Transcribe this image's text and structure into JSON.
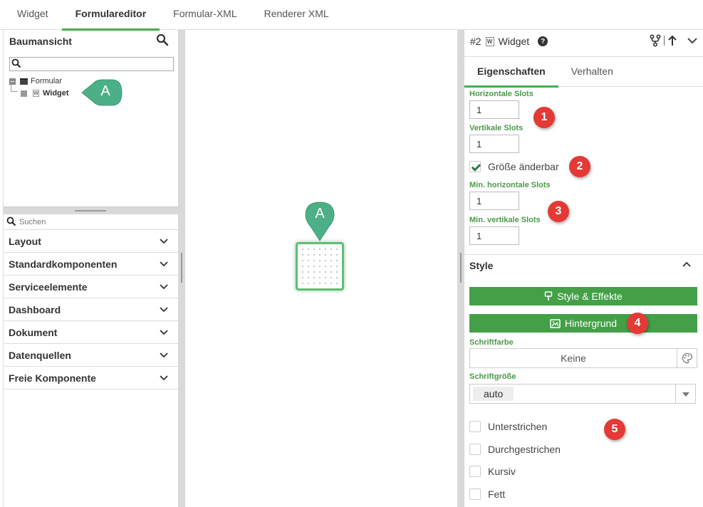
{
  "top_tabs": [
    {
      "label": "Widget",
      "active": false
    },
    {
      "label": "Formulareditor",
      "active": true
    },
    {
      "label": "Formular-XML",
      "active": false
    },
    {
      "label": "Renderer XML",
      "active": false
    }
  ],
  "tree": {
    "title": "Baumansicht",
    "search_value": "",
    "root_label": "Formular",
    "child_label": "Widget"
  },
  "components": {
    "search_placeholder": "Suchen",
    "items": [
      "Layout",
      "Standardkomponenten",
      "Serviceelemente",
      "Dashboard",
      "Dokument",
      "Datenquellen",
      "Freie Komponente"
    ]
  },
  "markers": {
    "tree_pin": "A",
    "canvas_pin": "A"
  },
  "props": {
    "id": "#2",
    "type_badge": "W",
    "type_name": "Widget",
    "tabs": [
      "Eigenschaften",
      "Verhalten"
    ],
    "h_slots_label": "Horizontale Slots",
    "h_slots_value": "1",
    "v_slots_label": "Vertikale Slots",
    "v_slots_value": "1",
    "resizable_label": "Größe änderbar",
    "resizable_checked": true,
    "min_h_label": "Min. horizontale Slots",
    "min_h_value": "1",
    "min_v_label": "Min. vertikale Slots",
    "min_v_value": "1"
  },
  "style": {
    "section_title": "Style",
    "effects_button": "Style & Effekte",
    "background_button": "Hintergrund",
    "font_color_label": "Schriftfarbe",
    "font_color_value": "Keine",
    "font_size_label": "Schriftgröße",
    "font_size_value": "auto",
    "checkboxes": [
      "Unterstrichen",
      "Durchgestrichen",
      "Kursiv",
      "Fett"
    ]
  },
  "callouts": [
    "1",
    "2",
    "3",
    "4",
    "5"
  ],
  "colors": {
    "accent_green": "#4caa4c",
    "button_green": "#43a047",
    "label_green": "#4a9a4a",
    "pin_green": "#4caf88",
    "callout_red": "#e53935"
  }
}
